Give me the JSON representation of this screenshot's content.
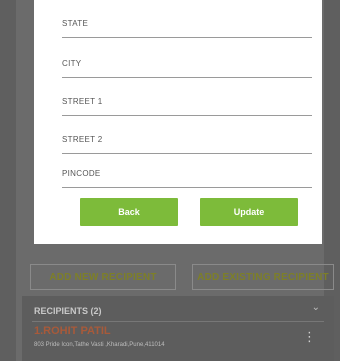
{
  "form": {
    "fields": [
      {
        "label": "STATE"
      },
      {
        "label": "CITY"
      },
      {
        "label": "STREET 1"
      },
      {
        "label": "STREET 2"
      },
      {
        "label": "PINCODE"
      }
    ],
    "back_label": "Back",
    "update_label": "Update"
  },
  "background": {
    "add_new_label": "ADD NEW RECIPIENT",
    "add_existing_label": "ADD EXISTING RECIPIENT",
    "recipients_header": "RECIPIENTS (2)",
    "recipient_name": "1.ROHIT PATIL",
    "recipient_address": "803 Pride Icon,Tathe Vasti ,Kharadi,Pune,411014"
  },
  "colors": {
    "primary_button": "#7dbb3a",
    "card_background": "#ffffff",
    "overlay": "#6b6b6b"
  }
}
